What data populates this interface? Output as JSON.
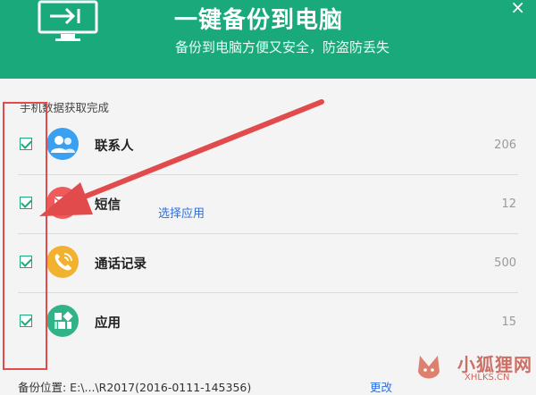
{
  "header": {
    "title": "一键备份到电脑",
    "subtitle": "备份到电脑方便又安全，防盗防丢失",
    "close_label": "×"
  },
  "status_text": "手机数据获取完成",
  "items": [
    {
      "label": "联系人",
      "count": "206",
      "icon": "contacts-icon",
      "color": "#3aa0ef"
    },
    {
      "label": "短信",
      "count": "12",
      "icon": "sms-icon",
      "color": "#ef5b5b"
    },
    {
      "label": "通话记录",
      "count": "500",
      "icon": "call-log-icon",
      "color": "#f2b12f"
    },
    {
      "label": "应用",
      "count": "15",
      "icon": "apps-icon",
      "color": "#30b487",
      "link": "选择应用"
    }
  ],
  "footer": {
    "path_label": "备份位置: E:\\...\\R2017(2016-0111-145356)",
    "change_label": "更改"
  },
  "watermark": {
    "text": "小狐狸网",
    "sub": "XHLKS.CN"
  },
  "colors": {
    "accent": "#1aa97b",
    "link": "#2f6edc",
    "annotation": "#e24b4b"
  }
}
